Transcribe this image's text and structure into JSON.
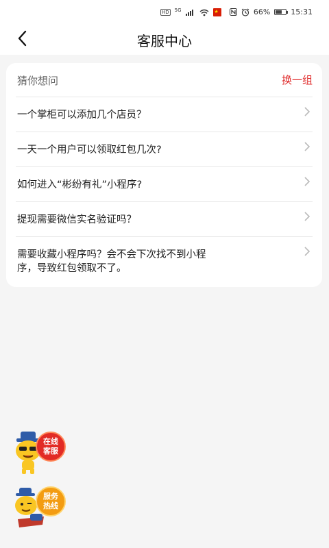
{
  "status_bar": {
    "hd_badge": "HD",
    "network": "5G",
    "battery_percent": "66%",
    "time": "15:31",
    "battery_level": 0.66
  },
  "header": {
    "title": "客服中心"
  },
  "faq": {
    "section_title": "猜你想问",
    "refresh_label": "换一组",
    "questions": [
      {
        "text": "一个掌柜可以添加几个店员？"
      },
      {
        "text": "一天一个用户可以领取红包几次?"
      },
      {
        "text": "如何进入“彬纷有礼”小程序?"
      },
      {
        "text": "提现需要微信实名验证吗？"
      },
      {
        "text": "需要收藏小程序吗？会不会下次找不到小程序，导致红包领取不了。"
      }
    ]
  },
  "floating": {
    "online_service_label_1": "在线",
    "online_service_label_2": "客服",
    "hotline_label_1": "服务",
    "hotline_label_2": "热线"
  },
  "colors": {
    "accent_red": "#e02d2d",
    "background": "#f5f5f5",
    "card": "#ffffff"
  }
}
